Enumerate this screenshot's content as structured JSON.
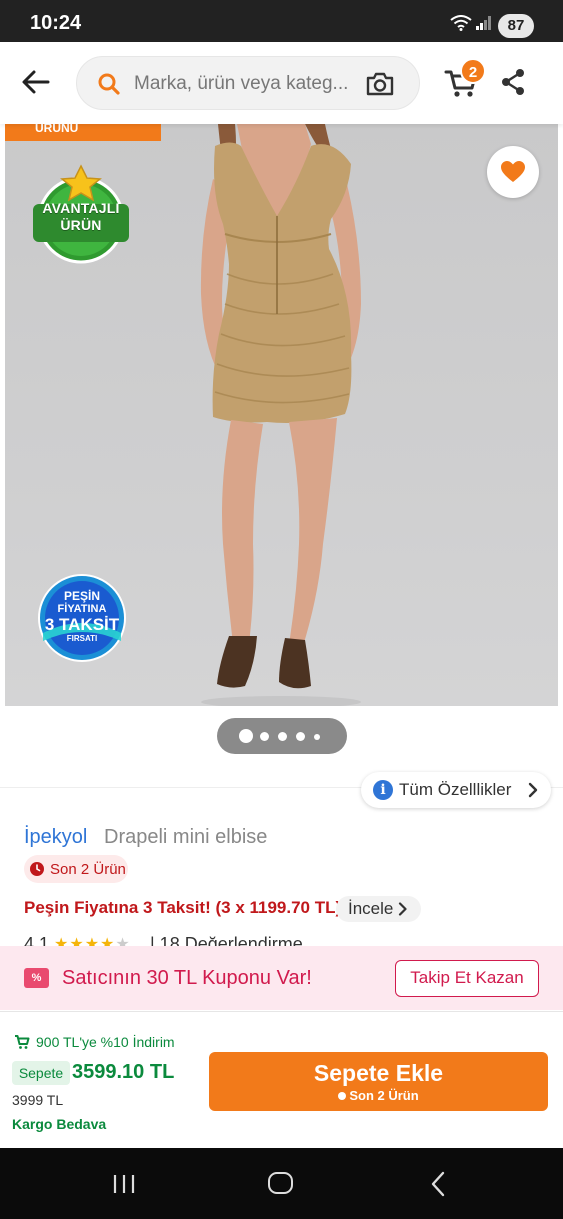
{
  "status_bar": {
    "time": "10:24",
    "battery": "87"
  },
  "search": {
    "placeholder": "Marka, ürün veya kateg..."
  },
  "cart": {
    "count": "2"
  },
  "image": {
    "ribbon_label": "ÜRÜNÜ",
    "badge_top": "AVANTAJLI ÜRÜN",
    "badge_bottom": {
      "line1": "PEŞİN",
      "line2": "FİYATINA",
      "line3": "3 TAKSİT",
      "line4": "FIRSATI"
    },
    "pager_count": 5,
    "pager_active": 0
  },
  "features_button": {
    "label": "Tüm Özelllikler"
  },
  "product": {
    "brand": "İpekyol",
    "name": "Drapeli mini elbise",
    "stock_badge": "Son 2 Ürün",
    "installment_text": "Peşin Fiyatına 3 Taksit! (3 x 1199.70 TL)",
    "installment_link": "İncele",
    "rating": "4.1",
    "stars_filled": 4,
    "reviews_text": "| 18 Değerlendirme"
  },
  "coupon": {
    "icon_text": "%",
    "text": "Satıcının 30 TL Kuponu Var!",
    "button": "Takip Et Kazan"
  },
  "bottom": {
    "discount_text": "900 TL'ye %10 İndirim",
    "basket_label": "Sepete",
    "basket_price": "3599.10 TL",
    "old_price": "3999 TL",
    "shipping": "Kargo Bedava",
    "add_to_cart": "Sepete Ekle",
    "add_to_cart_sub": "Son 2 Ürün"
  },
  "colors": {
    "accent": "#f27a1a",
    "brand_blue": "#2f75d6",
    "alert_red": "#c0181b",
    "coupon_pink": "#d11a4d",
    "green": "#0b8a3d"
  }
}
